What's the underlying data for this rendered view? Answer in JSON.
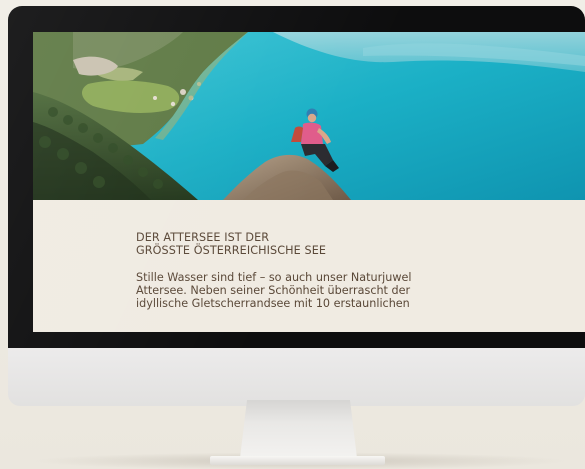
{
  "article": {
    "headline_line1": "DER ATTERSEE IST DER",
    "headline_line2": "GRÖSSTE ÖSTERREICHISCHE SEE",
    "body_line1": "Stille Wasser sind tief – so auch unser Naturjuwel",
    "body_line2": "Attersee. Neben seiner Schönheit überrascht der",
    "body_line3": "idyllische Gletscherrandsee mit 10 erstaunlichen"
  },
  "hero": {
    "image_subject": "hiker-on-rock-above-lake-image"
  },
  "colors": {
    "page_background": "#f0ebe2",
    "text": "#5a4838",
    "lake": "#1fb3c7",
    "bezel": "#0d0d0e"
  }
}
